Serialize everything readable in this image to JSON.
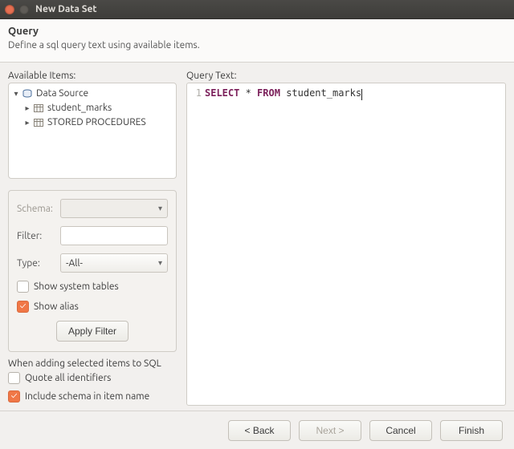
{
  "window": {
    "title": "New Data Set"
  },
  "header": {
    "title": "Query",
    "subtitle": "Define a sql query text using available items."
  },
  "left": {
    "available_label": "Available Items:",
    "tree": {
      "root": "Data Source",
      "children": [
        "student_marks",
        "STORED PROCEDURES"
      ]
    },
    "filter": {
      "schema_label": "Schema:",
      "filter_label": "Filter:",
      "filter_value": "",
      "type_label": "Type:",
      "type_value": "-All-",
      "show_system_label": "Show system tables",
      "show_system_checked": false,
      "show_alias_label": "Show alias",
      "show_alias_checked": true,
      "apply_label": "Apply Filter"
    },
    "when": {
      "title": "When adding selected items to SQL",
      "quote_label": "Quote all identifiers",
      "quote_checked": false,
      "include_schema_label": "Include schema in item name",
      "include_schema_checked": true
    }
  },
  "right": {
    "query_label": "Query Text:",
    "line_no": "1",
    "kw_select": "SELECT",
    "kw_from": "FROM",
    "star": " * ",
    "table": "student_marks"
  },
  "footer": {
    "back": "< Back",
    "next": "Next >",
    "cancel": "Cancel",
    "finish": "Finish"
  }
}
